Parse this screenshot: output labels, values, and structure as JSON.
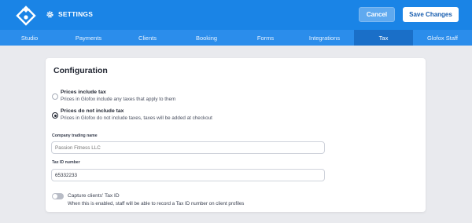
{
  "header": {
    "title": "SETTINGS",
    "cancel_label": "Cancel",
    "save_label": "Save Changes",
    "accent_color": "#1a84e6"
  },
  "tabs": [
    {
      "label": "Studio",
      "active": false
    },
    {
      "label": "Payments",
      "active": false
    },
    {
      "label": "Clients",
      "active": false
    },
    {
      "label": "Booking",
      "active": false
    },
    {
      "label": "Forms",
      "active": false
    },
    {
      "label": "Integrations",
      "active": false
    },
    {
      "label": "Tax",
      "active": true
    },
    {
      "label": "Glofox Staff",
      "active": false
    }
  ],
  "configuration": {
    "title": "Configuration",
    "options": [
      {
        "title": "Prices include tax",
        "description": "Prices in Glofox include any taxes that apply to them",
        "selected": false
      },
      {
        "title": "Prices do not include tax",
        "description": "Prices in Glofox do not include taxes, taxes will be added at checkout",
        "selected": true
      }
    ],
    "company_name": {
      "label": "Company trading name",
      "placeholder": "Passion Fitness LLC"
    },
    "tax_id": {
      "label": "Tax ID number",
      "value": "65332233"
    },
    "capture": {
      "label": "Capture clients' Tax ID",
      "description": "When this is enabled, staff will be able to record a Tax ID number on client profiles",
      "enabled": false
    }
  }
}
